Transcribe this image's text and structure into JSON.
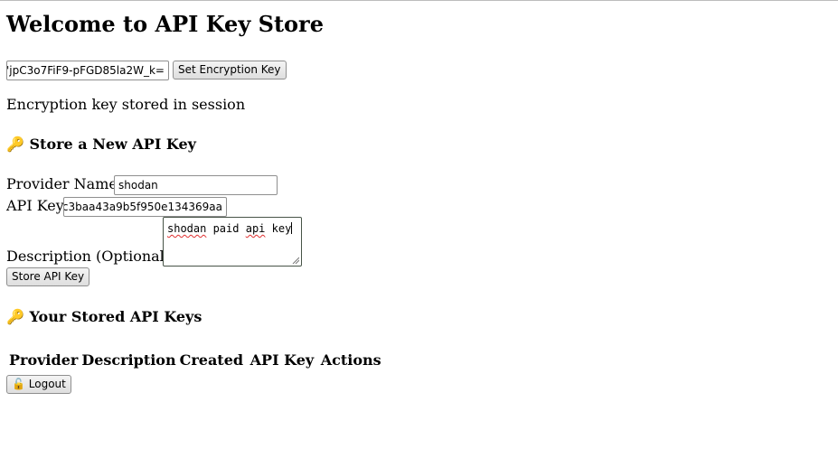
{
  "page": {
    "title": "Welcome to API Key Store"
  },
  "encryption": {
    "key_value": "'jpC3o7FiF9-pFGD85la2W_k=",
    "set_button_label": "Set Encryption Key",
    "status_text": "Encryption key stored in session"
  },
  "store_form": {
    "heading_icon": "key-icon",
    "heading_icon_glyph": "🔑",
    "heading": "Store a New API Key",
    "provider_label": "Provider Name",
    "provider_value": "shodan",
    "api_key_label": "API Key",
    "api_key_value": "c3baa43a9b5f950e134369aa",
    "description_label": "Description (Optional)",
    "description_words": [
      "shodan",
      " paid ",
      "api",
      " key"
    ],
    "submit_label": "Store API Key"
  },
  "stored_keys": {
    "heading_icon": "key-icon",
    "heading_icon_glyph": "🔑",
    "heading": "Your Stored API Keys",
    "columns": [
      "Provider",
      "Description",
      "Created",
      "API Key",
      "Actions"
    ]
  },
  "logout": {
    "icon": "unlock-icon",
    "icon_glyph": "🔓",
    "label": "Logout"
  },
  "colors": {
    "textarea_border": "#475447",
    "spellcheck_underline": "#e03030"
  }
}
